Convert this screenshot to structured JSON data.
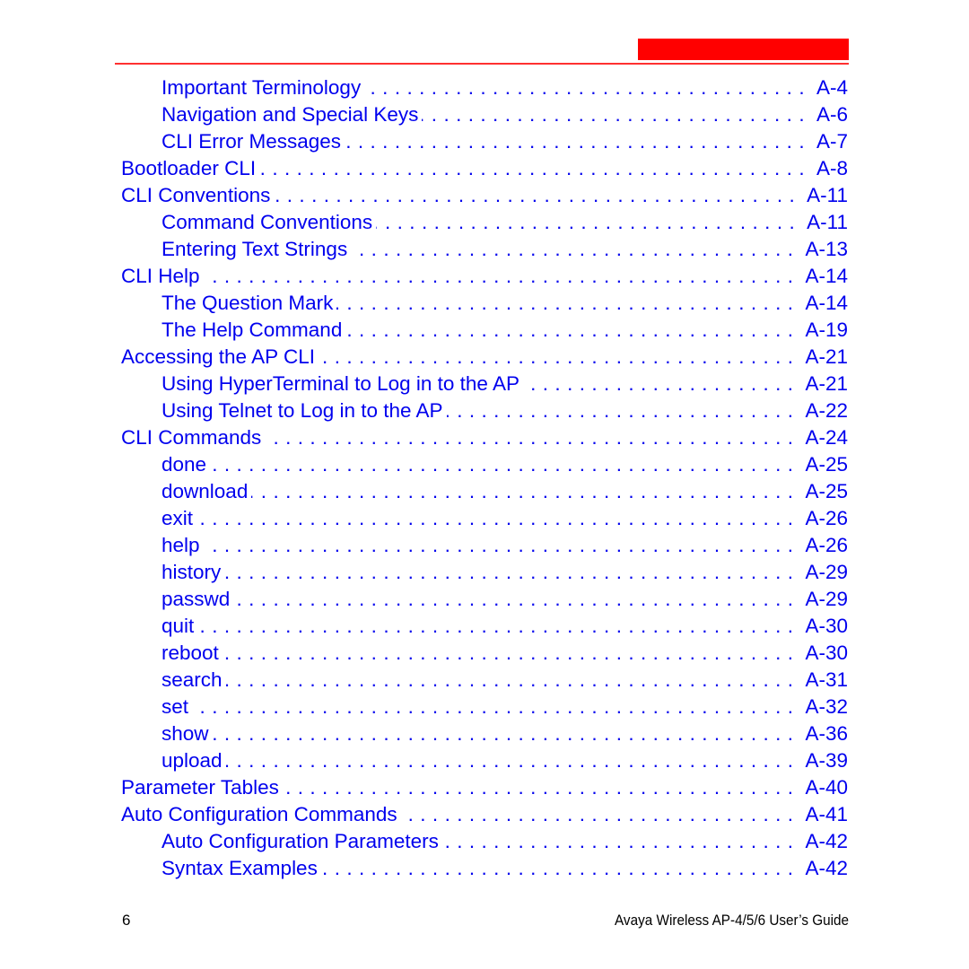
{
  "header": {
    "accent_color": "#ff0000"
  },
  "toc": [
    {
      "label": "Important Terminology",
      "page": "A-4",
      "level": 2
    },
    {
      "label": "Navigation and Special Keys",
      "page": "A-6",
      "level": 2
    },
    {
      "label": "CLI Error Messages",
      "page": "A-7",
      "level": 2
    },
    {
      "label": "Bootloader CLI",
      "page": "A-8",
      "level": 1
    },
    {
      "label": "CLI Conventions",
      "page": "A-11",
      "level": 1
    },
    {
      "label": "Command Conventions",
      "page": "A-11",
      "level": 2
    },
    {
      "label": "Entering Text Strings",
      "page": "A-13",
      "level": 2
    },
    {
      "label": "CLI Help",
      "page": "A-14",
      "level": 1
    },
    {
      "label": "The Question Mark",
      "page": "A-14",
      "level": 2
    },
    {
      "label": "The Help Command",
      "page": "A-19",
      "level": 2
    },
    {
      "label": "Accessing the AP CLI",
      "page": "A-21",
      "level": 1
    },
    {
      "label": "Using HyperTerminal to Log in to the AP",
      "page": "A-21",
      "level": 2
    },
    {
      "label": "Using Telnet to Log in to the AP",
      "page": "A-22",
      "level": 2
    },
    {
      "label": "CLI Commands",
      "page": "A-24",
      "level": 1
    },
    {
      "label": "done",
      "page": "A-25",
      "level": 2
    },
    {
      "label": "download",
      "page": "A-25",
      "level": 2
    },
    {
      "label": "exit",
      "page": "A-26",
      "level": 2
    },
    {
      "label": "help",
      "page": "A-26",
      "level": 2
    },
    {
      "label": "history",
      "page": "A-29",
      "level": 2
    },
    {
      "label": "passwd",
      "page": "A-29",
      "level": 2
    },
    {
      "label": "quit",
      "page": "A-30",
      "level": 2
    },
    {
      "label": "reboot",
      "page": "A-30",
      "level": 2
    },
    {
      "label": "search",
      "page": "A-31",
      "level": 2
    },
    {
      "label": "set",
      "page": "A-32",
      "level": 2
    },
    {
      "label": "show",
      "page": "A-36",
      "level": 2
    },
    {
      "label": "upload",
      "page": "A-39",
      "level": 2
    },
    {
      "label": "Parameter Tables",
      "page": "A-40",
      "level": 1
    },
    {
      "label": "Auto Configuration Commands",
      "page": "A-41",
      "level": 1
    },
    {
      "label": "Auto Configuration Parameters",
      "page": "A-42",
      "level": 2
    },
    {
      "label": "Syntax Examples",
      "page": "A-42",
      "level": 2
    }
  ],
  "footer": {
    "page_number": "6",
    "document_title": "Avaya Wireless AP-4/5/6 User’s Guide"
  }
}
